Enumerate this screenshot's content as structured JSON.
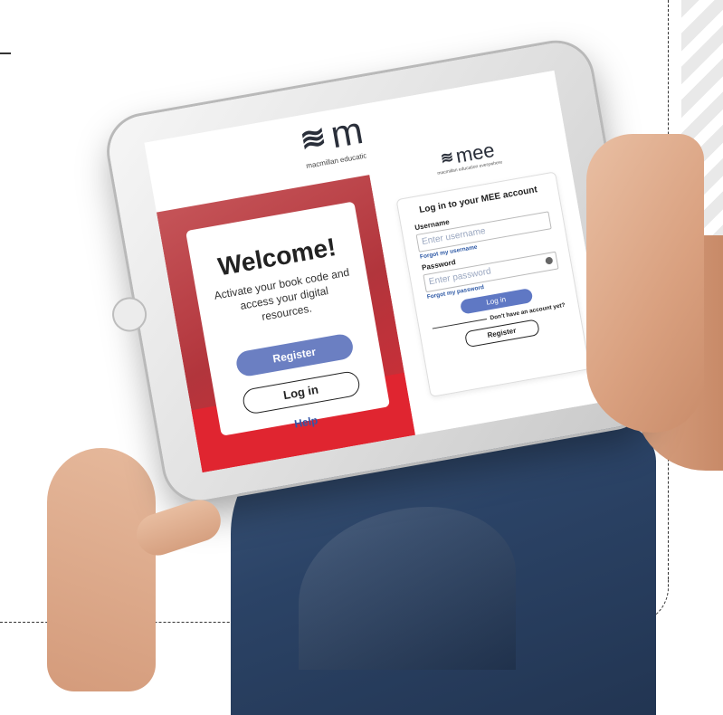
{
  "brand": {
    "logo_text": "mee",
    "tagline": "macmillan education everywhere"
  },
  "welcome_card": {
    "title": "Welcome!",
    "subtitle": "Activate your book code and access your digital resources.",
    "register_label": "Register",
    "login_label": "Log in",
    "help_label": "Help"
  },
  "login_card": {
    "title": "Log in to your MEE account",
    "username_label": "Username",
    "username_placeholder": "Enter username",
    "forgot_username": "Forgot my username",
    "password_label": "Password",
    "password_placeholder": "Enter password",
    "forgot_password": "Forgot my password",
    "login_button": "Log in",
    "no_account_text": "Don't have an account yet?",
    "register_button": "Register"
  },
  "colors": {
    "accent_blue": "#6b7fc2",
    "brand_red": "#e02530",
    "link_blue": "#2f5aa6"
  },
  "icons": [
    "logo-mark-icon",
    "password-visibility-icon"
  ]
}
